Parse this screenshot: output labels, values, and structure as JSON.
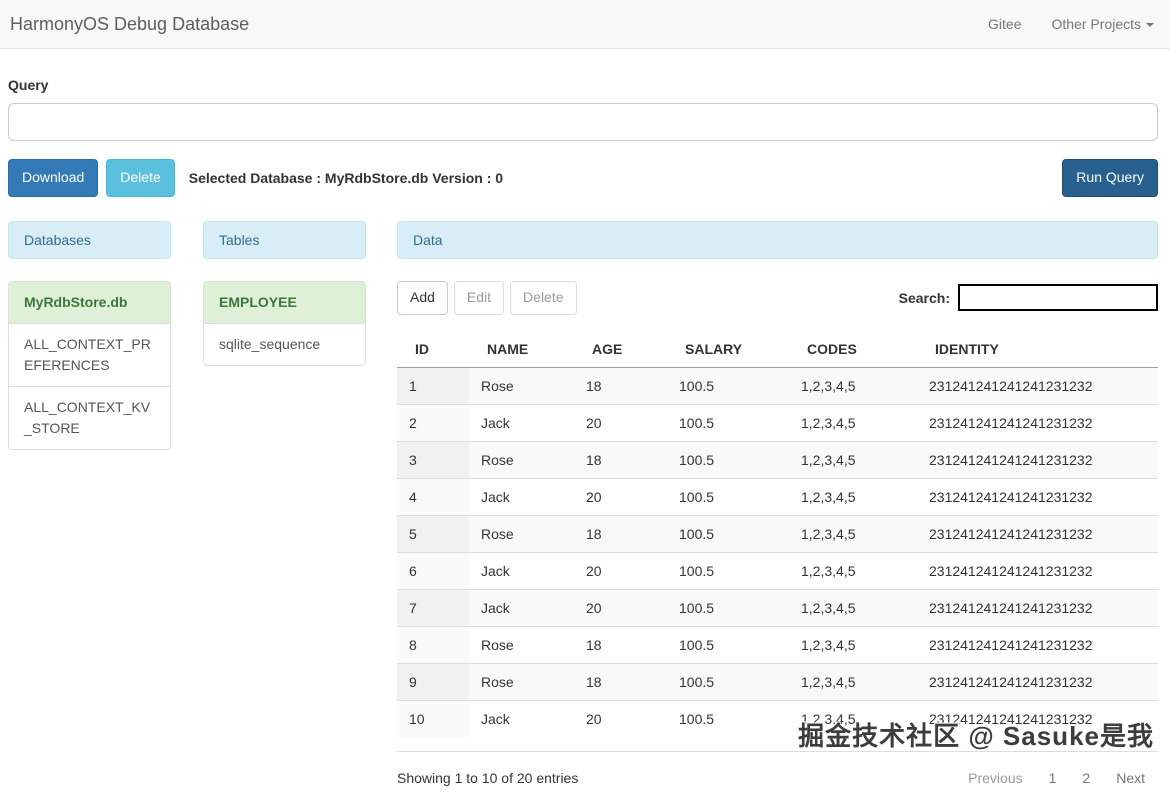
{
  "navbar": {
    "brand": "HarmonyOS Debug Database",
    "links": [
      {
        "label": "Gitee"
      },
      {
        "label": "Other Projects"
      }
    ]
  },
  "query": {
    "label": "Query",
    "value": ""
  },
  "actions": {
    "download_label": "Download",
    "delete_label": "Delete",
    "selected_info": "Selected Database : MyRdbStore.db Version : 0",
    "run_query_label": "Run Query"
  },
  "databases_panel": {
    "title": "Databases",
    "items": [
      {
        "label": "MyRdbStore.db",
        "selected": true
      },
      {
        "label": "ALL_CONTEXT_PREFERENCES",
        "selected": false
      },
      {
        "label": "ALL_CONTEXT_KV_STORE",
        "selected": false
      }
    ]
  },
  "tables_panel": {
    "title": "Tables",
    "items": [
      {
        "label": "EMPLOYEE",
        "selected": true
      },
      {
        "label": "sqlite_sequence",
        "selected": false
      }
    ]
  },
  "data_panel": {
    "title": "Data",
    "toolbar": {
      "add_label": "Add",
      "edit_label": "Edit",
      "delete_label": "Delete",
      "search_label": "Search:",
      "search_value": ""
    },
    "table": {
      "columns": [
        "ID",
        "NAME",
        "AGE",
        "SALARY",
        "CODES",
        "IDENTITY"
      ],
      "rows": [
        [
          "1",
          "Rose",
          "18",
          "100.5",
          "1,2,3,4,5",
          "231241241241241231232"
        ],
        [
          "2",
          "Jack",
          "20",
          "100.5",
          "1,2,3,4,5",
          "231241241241241231232"
        ],
        [
          "3",
          "Rose",
          "18",
          "100.5",
          "1,2,3,4,5",
          "231241241241241231232"
        ],
        [
          "4",
          "Jack",
          "20",
          "100.5",
          "1,2,3,4,5",
          "231241241241241231232"
        ],
        [
          "5",
          "Rose",
          "18",
          "100.5",
          "1,2,3,4,5",
          "231241241241241231232"
        ],
        [
          "6",
          "Jack",
          "20",
          "100.5",
          "1,2,3,4,5",
          "231241241241241231232"
        ],
        [
          "7",
          "Jack",
          "20",
          "100.5",
          "1,2,3,4,5",
          "231241241241241231232"
        ],
        [
          "8",
          "Rose",
          "18",
          "100.5",
          "1,2,3,4,5",
          "231241241241241231232"
        ],
        [
          "9",
          "Rose",
          "18",
          "100.5",
          "1,2,3,4,5",
          "231241241241241231232"
        ],
        [
          "10",
          "Jack",
          "20",
          "100.5",
          "1,2,3,4,5",
          "231241241241241231232"
        ]
      ]
    },
    "footer": {
      "showing_info": "Showing 1 to 10 of 20 entries",
      "pagination": [
        "Previous",
        "1",
        "2",
        "Next"
      ]
    }
  },
  "watermark": "掘金技术社区 @ Sasuke是我",
  "colors": {
    "primary_button": "#337ab7",
    "info_button": "#5bc0de",
    "run_query_button": "#286090",
    "panel_heading_bg": "#d9edf7",
    "panel_heading_text": "#31708f",
    "selected_item_bg": "#dff0d8",
    "selected_item_text": "#3c763d"
  }
}
